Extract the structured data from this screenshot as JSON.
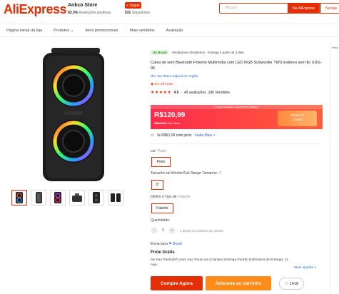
{
  "header": {
    "logo": "AliExpress",
    "store_name": "Ankco Store",
    "store_positive": "93.3%",
    "store_positive_label": "Avaliações positivas",
    "follow_label": "+ Seguir",
    "followers_count": "531",
    "followers_label": "Seguidores",
    "search_placeholder": "Buscar",
    "search_btn_ali": "No AliExpress",
    "search_btn_store": "Na loja"
  },
  "nav": [
    "Página inicial da loja",
    "Produtos",
    "Itens promocionais",
    "Mais vendidos",
    "Avaliação"
  ],
  "product": {
    "brand_badge": "Do Brasil",
    "brand_text": "Vendedores Brasileiros · Entrega a partir de 3 dias",
    "title": "Caixa de som Bluetooth Potente Multimídia com LED RGB Subwoofer TWS Estéreo sem fio XDG-96",
    "translate": "Ver título original em inglês",
    "discount_extra": "5% off extra",
    "stars": "★★★★★",
    "rating": "4.5",
    "reviews": "49 avaliações",
    "sold": "186 Vendidos"
  },
  "price": {
    "banner": "Preço exclusivo na primeira compra",
    "current": "R$120,99",
    "old": "R$159,99",
    "off": "24% desc.",
    "offer_line1": "Oferta 1ª",
    "offer_line2": "compra"
  },
  "installment": {
    "text": "2x R$61,09 com juros",
    "more": "Saiba Mais >"
  },
  "options": {
    "color_label": "cor:",
    "color_value": "Preto",
    "color_btn": "Preto",
    "size_label": "Tamanho do Woofer/Full-Range Tamanho:",
    "size_value": "3\"",
    "size_btn": "3\"",
    "type_label": "Definir o Tipo de:",
    "type_value": "Falante",
    "type_btn": "Falante"
  },
  "quantity": {
    "label": "Quantidade:",
    "value": "1",
    "minus": "−",
    "plus": "+",
    "note": "1 peças no máximo por cliente"
  },
  "shipping": {
    "to_label": "Envia para",
    "to_country": "Brasil",
    "frete": "Frete Grátis",
    "desc": "De Sao Paulo(SP) para Sao Paulo via (Cainiao) Entrega Padrão Estimativa de Entrega: 11 Ago.",
    "more": "Mais opções >"
  },
  "actions": {
    "buy": "Compre Agora",
    "cart": "Adicione ao carrinho",
    "wish_count": "1418"
  },
  "right_edge": "Reco"
}
